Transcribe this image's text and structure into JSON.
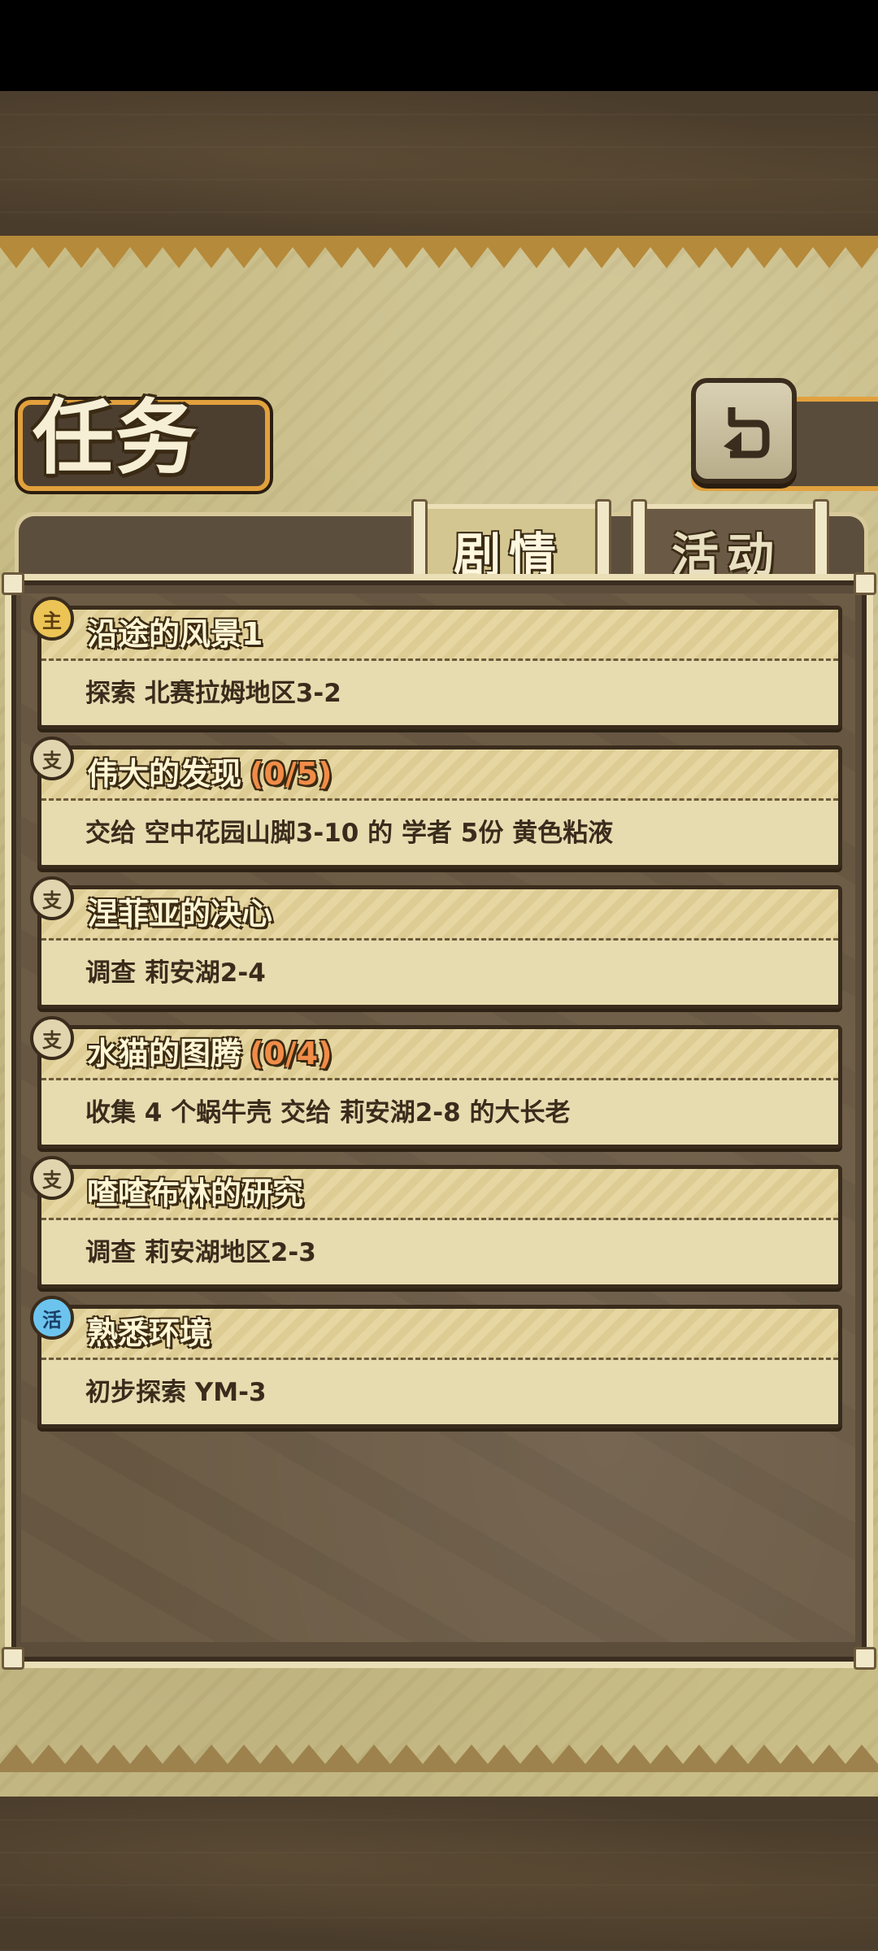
{
  "header": {
    "title": "任务",
    "back_icon": "return-arrow-icon"
  },
  "tabs": [
    {
      "label": "剧情",
      "active": true
    },
    {
      "label": "活动",
      "active": false
    }
  ],
  "quests": [
    {
      "badge": "主",
      "type": "main",
      "title": "沿途的风景1",
      "progress": "",
      "description": "探索 北赛拉姆地区3-2"
    },
    {
      "badge": "支",
      "type": "side",
      "title": "伟大的发现",
      "progress": "(0/5)",
      "description": "交给 空中花园山脚3-10 的 学者 5份 黄色粘液"
    },
    {
      "badge": "支",
      "type": "side",
      "title": "涅菲亚的决心",
      "progress": "",
      "description": "调查 莉安湖2-4"
    },
    {
      "badge": "支",
      "type": "side",
      "title": "水猫的图腾",
      "progress": "(0/4)",
      "description": "收集 4 个蜗牛壳 交给 莉安湖2-8 的大长老"
    },
    {
      "badge": "支",
      "type": "side",
      "title": "喳喳布林的研究",
      "progress": "",
      "description": "调查 莉安湖地区2-3"
    },
    {
      "badge": "活",
      "type": "event",
      "title": "熟悉环境",
      "progress": "",
      "description": "初步探索 YM-3"
    }
  ],
  "colors": {
    "panel": "#c9bd87",
    "frame_orange": "#e2a13d",
    "progress_orange": "#f08c48",
    "event_badge": "#6cc4ee"
  }
}
